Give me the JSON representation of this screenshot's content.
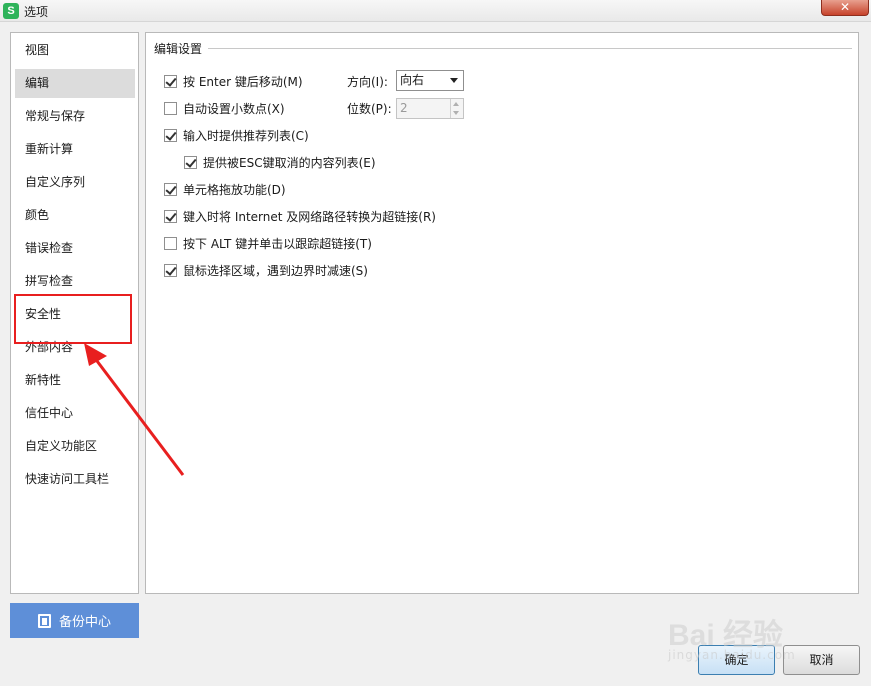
{
  "window": {
    "app_icon_letter": "S",
    "title": "选项",
    "close_glyph": "✕"
  },
  "sidebar": {
    "items": [
      {
        "label": "视图"
      },
      {
        "label": "编辑",
        "selected": true
      },
      {
        "label": "常规与保存"
      },
      {
        "label": "重新计算"
      },
      {
        "label": "自定义序列"
      },
      {
        "label": "颜色"
      },
      {
        "label": "错误检查"
      },
      {
        "label": "拼写检查"
      },
      {
        "label": "安全性",
        "highlighted": true
      },
      {
        "label": "外部内容"
      },
      {
        "label": "新特性"
      },
      {
        "label": "信任中心"
      },
      {
        "label": "自定义功能区"
      },
      {
        "label": "快速访问工具栏"
      }
    ],
    "backup_button": {
      "label": "备份中心",
      "icon": "backup-icon"
    }
  },
  "edit_settings": {
    "section_title": "编辑设置",
    "options": [
      {
        "label": "按 Enter 键后移动(M)",
        "checked": true
      },
      {
        "label": "自动设置小数点(X)",
        "checked": false
      },
      {
        "label": "输入时提供推荐列表(C)",
        "checked": true
      },
      {
        "label": "提供被ESC键取消的内容列表(E)",
        "checked": true
      },
      {
        "label": "单元格拖放功能(D)",
        "checked": true
      },
      {
        "label": "键入时将 Internet 及网络路径转换为超链接(R)",
        "checked": true
      },
      {
        "label": "按下 ALT 键并单击以跟踪超链接(T)",
        "checked": false
      },
      {
        "label": "鼠标选择区域，遇到边界时减速(S)",
        "checked": true
      }
    ],
    "direction": {
      "label": "方向(I):",
      "value": "向右"
    },
    "decimal_places": {
      "label": "位数(P):",
      "value": "2",
      "disabled": true
    }
  },
  "footer": {
    "ok_label": "确定",
    "cancel_label": "取消"
  },
  "annotation": {
    "color": "#e81f1f"
  },
  "watermark": {
    "main": "Bai 经验",
    "sub": "jingyan.baidu.com"
  },
  "colors": {
    "backup_button": "#5e8fd8",
    "selected_item": "#dcdcdc",
    "close_button": "#c7432b"
  }
}
